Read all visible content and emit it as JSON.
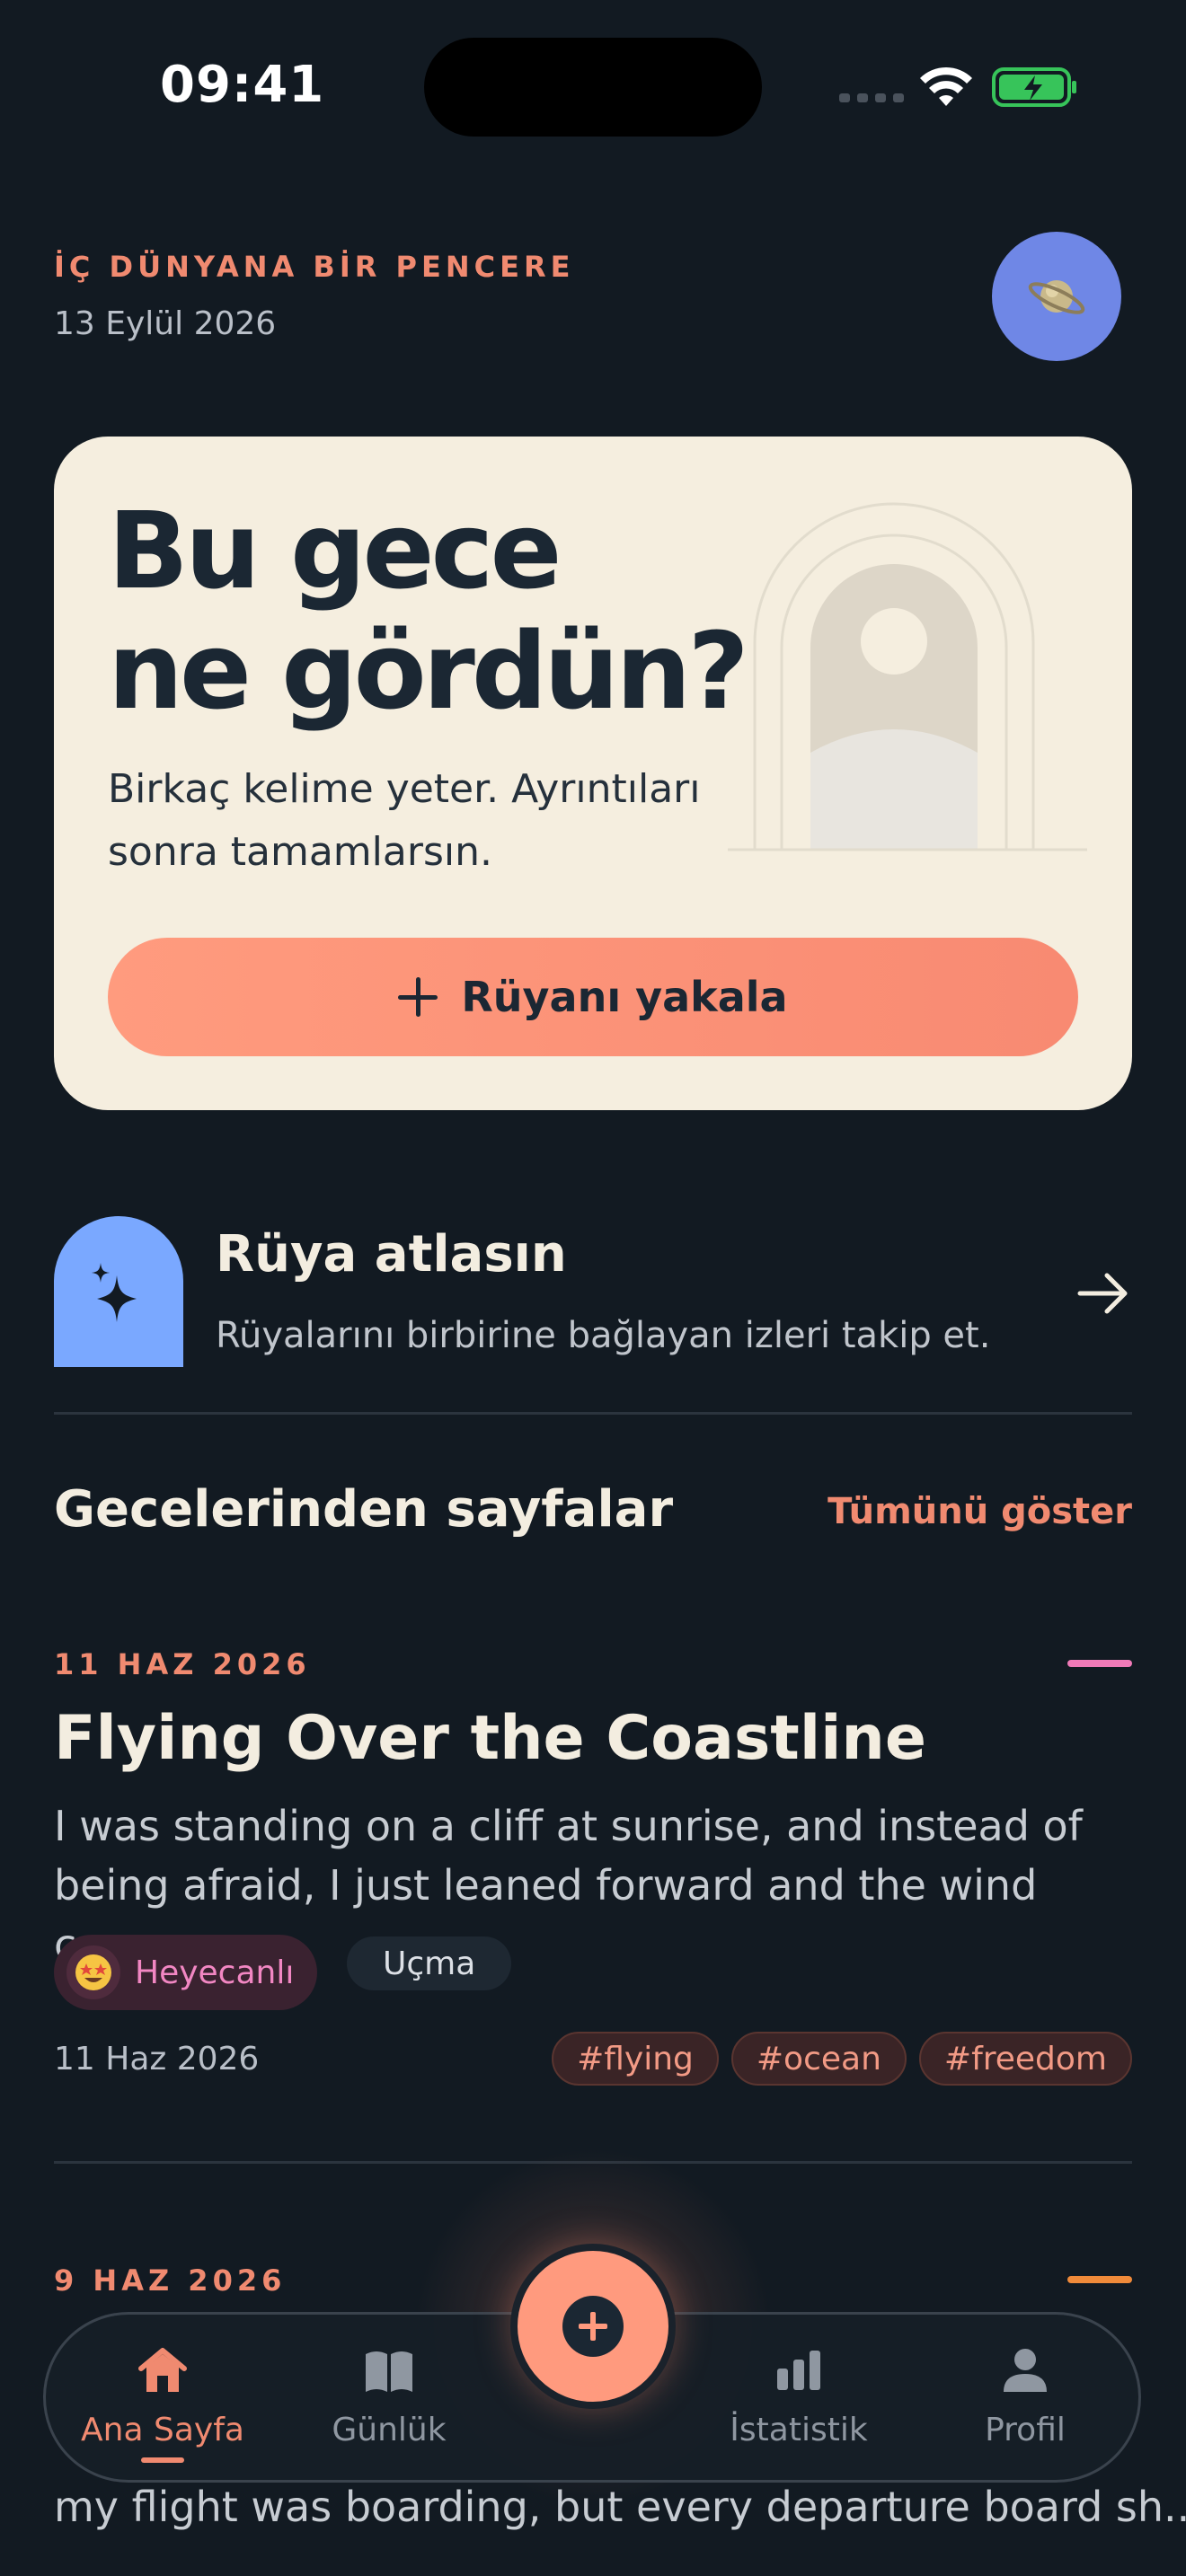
{
  "status_bar": {
    "time": "09:41"
  },
  "header": {
    "eyebrow": "İÇ DÜNYANA BİR PENCERE",
    "date": "13 Eylül 2026",
    "avatar_icon": "saturn-icon"
  },
  "hero": {
    "title_line1": "Bu gece",
    "title_line2": "ne gördün?",
    "subtitle": "Birkaç kelime yeter. Ayrıntıları sonra tamamlarsın.",
    "cta_label": "Rüyanı yakala"
  },
  "atlas": {
    "title": "Rüya atlasın",
    "subtitle": "Rüyalarını birbirine bağlayan izleri takip et."
  },
  "section": {
    "title": "Gecelerinden sayfalar",
    "link": "Tümünü göster"
  },
  "dreams": [
    {
      "date_caps": "11 HAZ 2026",
      "accent": "#f07ab8",
      "title": "Flying Over the Coastline",
      "excerpt": "I was standing on a cliff at sunrise, and instead of being afraid, I just leaned forward and the wind caug...",
      "mood": "Heyecanlı",
      "theme": "Uçma",
      "date": "11 Haz 2026",
      "tags": [
        "#flying",
        "#ocean",
        "#freedom"
      ]
    },
    {
      "date_caps": "9 HAZ 2026",
      "accent": "#f08a3a",
      "excerpt_partial": "my flight was boarding, but every departure board sh..."
    }
  ],
  "tabbar": {
    "home": "Ana Sayfa",
    "journal": "Günlük",
    "stats": "İstatistik",
    "profile": "Profil"
  }
}
